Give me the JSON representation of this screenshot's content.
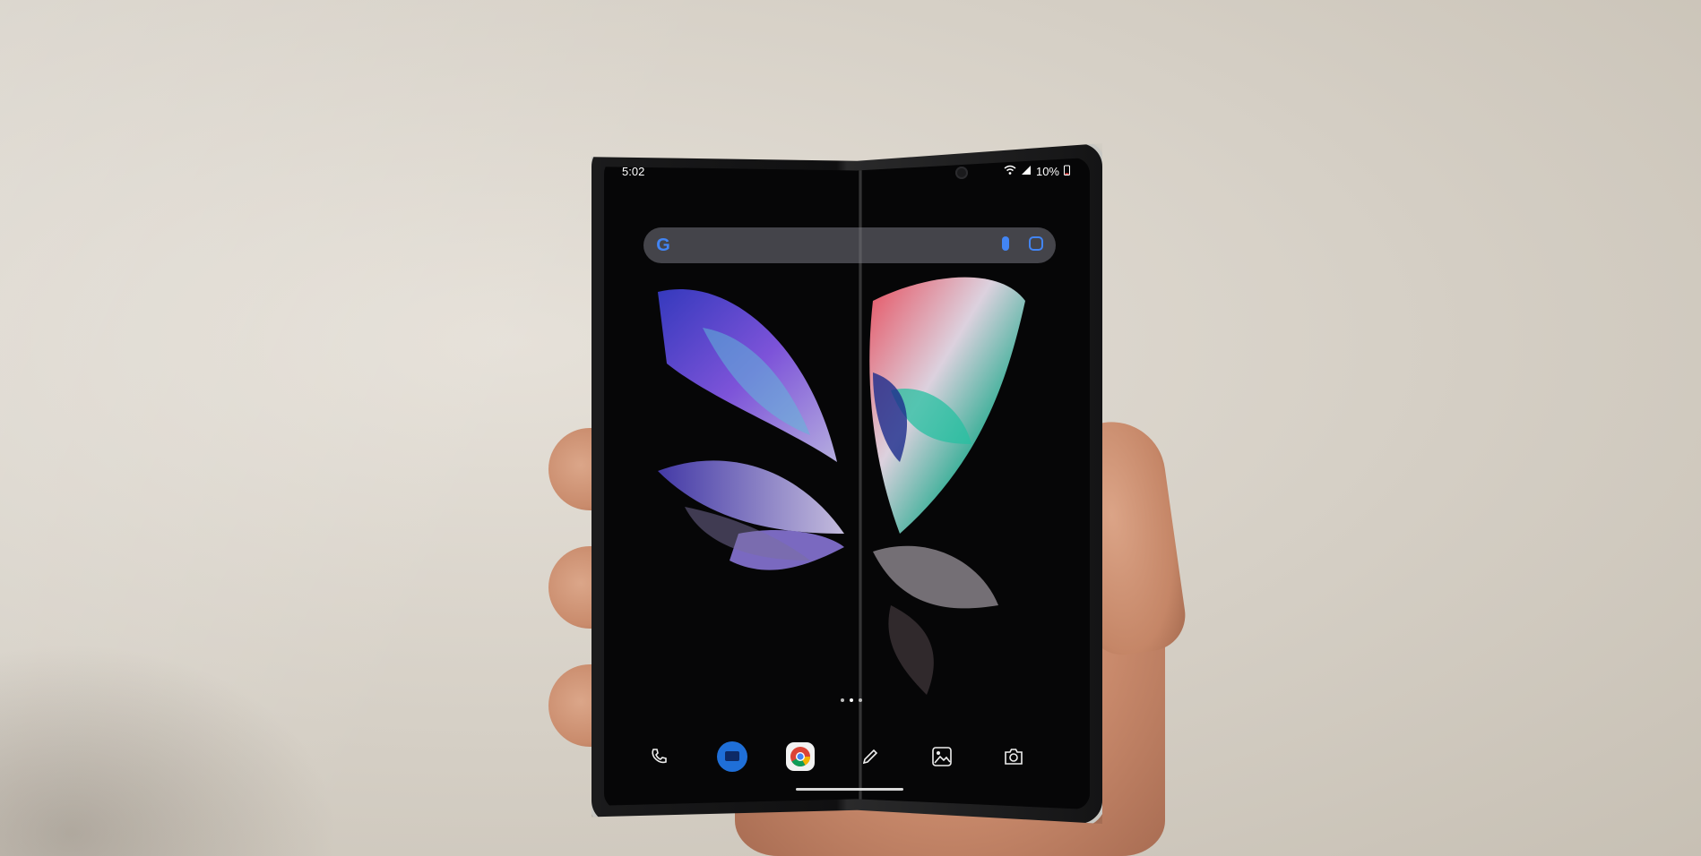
{
  "status_bar": {
    "time": "5:02",
    "battery": "10%"
  },
  "search_bar": {
    "brand_glyph": "G"
  },
  "dock": {
    "icons": [
      "phone-icon",
      "messages-icon",
      "chrome-icon",
      "pencil-icon",
      "gallery-icon",
      "camera-icon"
    ]
  },
  "page_indicator": {
    "pages": 3,
    "active": 2
  },
  "colors": {
    "wall": "#d8d2c8",
    "phone_frame": "#c8c8c4",
    "screen_bg": "#060607",
    "google_blue": "#4285f4"
  }
}
